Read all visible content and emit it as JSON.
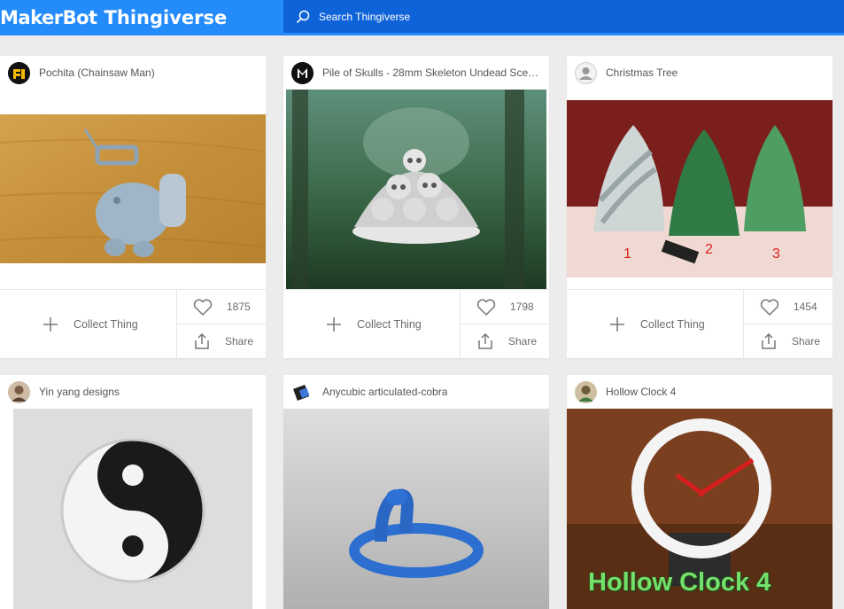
{
  "header": {
    "brand_makerbot": "MakerBot",
    "brand_thingiverse": "Thingiverse",
    "search_placeholder": "Search Thingiverse"
  },
  "cards": [
    {
      "title": "Pochita (Chainsaw Man)",
      "collect_label": "Collect Thing",
      "likes": "1875",
      "share_label": "Share"
    },
    {
      "title": "Pile of Skulls - 28mm Skeleton Undead Scen...",
      "collect_label": "Collect Thing",
      "likes": "1798",
      "share_label": "Share"
    },
    {
      "title": "Christmas Tree",
      "collect_label": "Collect Thing",
      "likes": "1454",
      "share_label": "Share"
    },
    {
      "title": "Yin yang designs"
    },
    {
      "title": "Anycubic articulated-cobra"
    },
    {
      "title": "Hollow Clock 4",
      "image_caption": "Hollow Clock 4"
    }
  ],
  "tree_numbers": [
    "1",
    "2",
    "3"
  ],
  "colors": {
    "header_blue": "#248bfb",
    "search_blue": "#0f63d8",
    "page_bg": "#ececec"
  }
}
